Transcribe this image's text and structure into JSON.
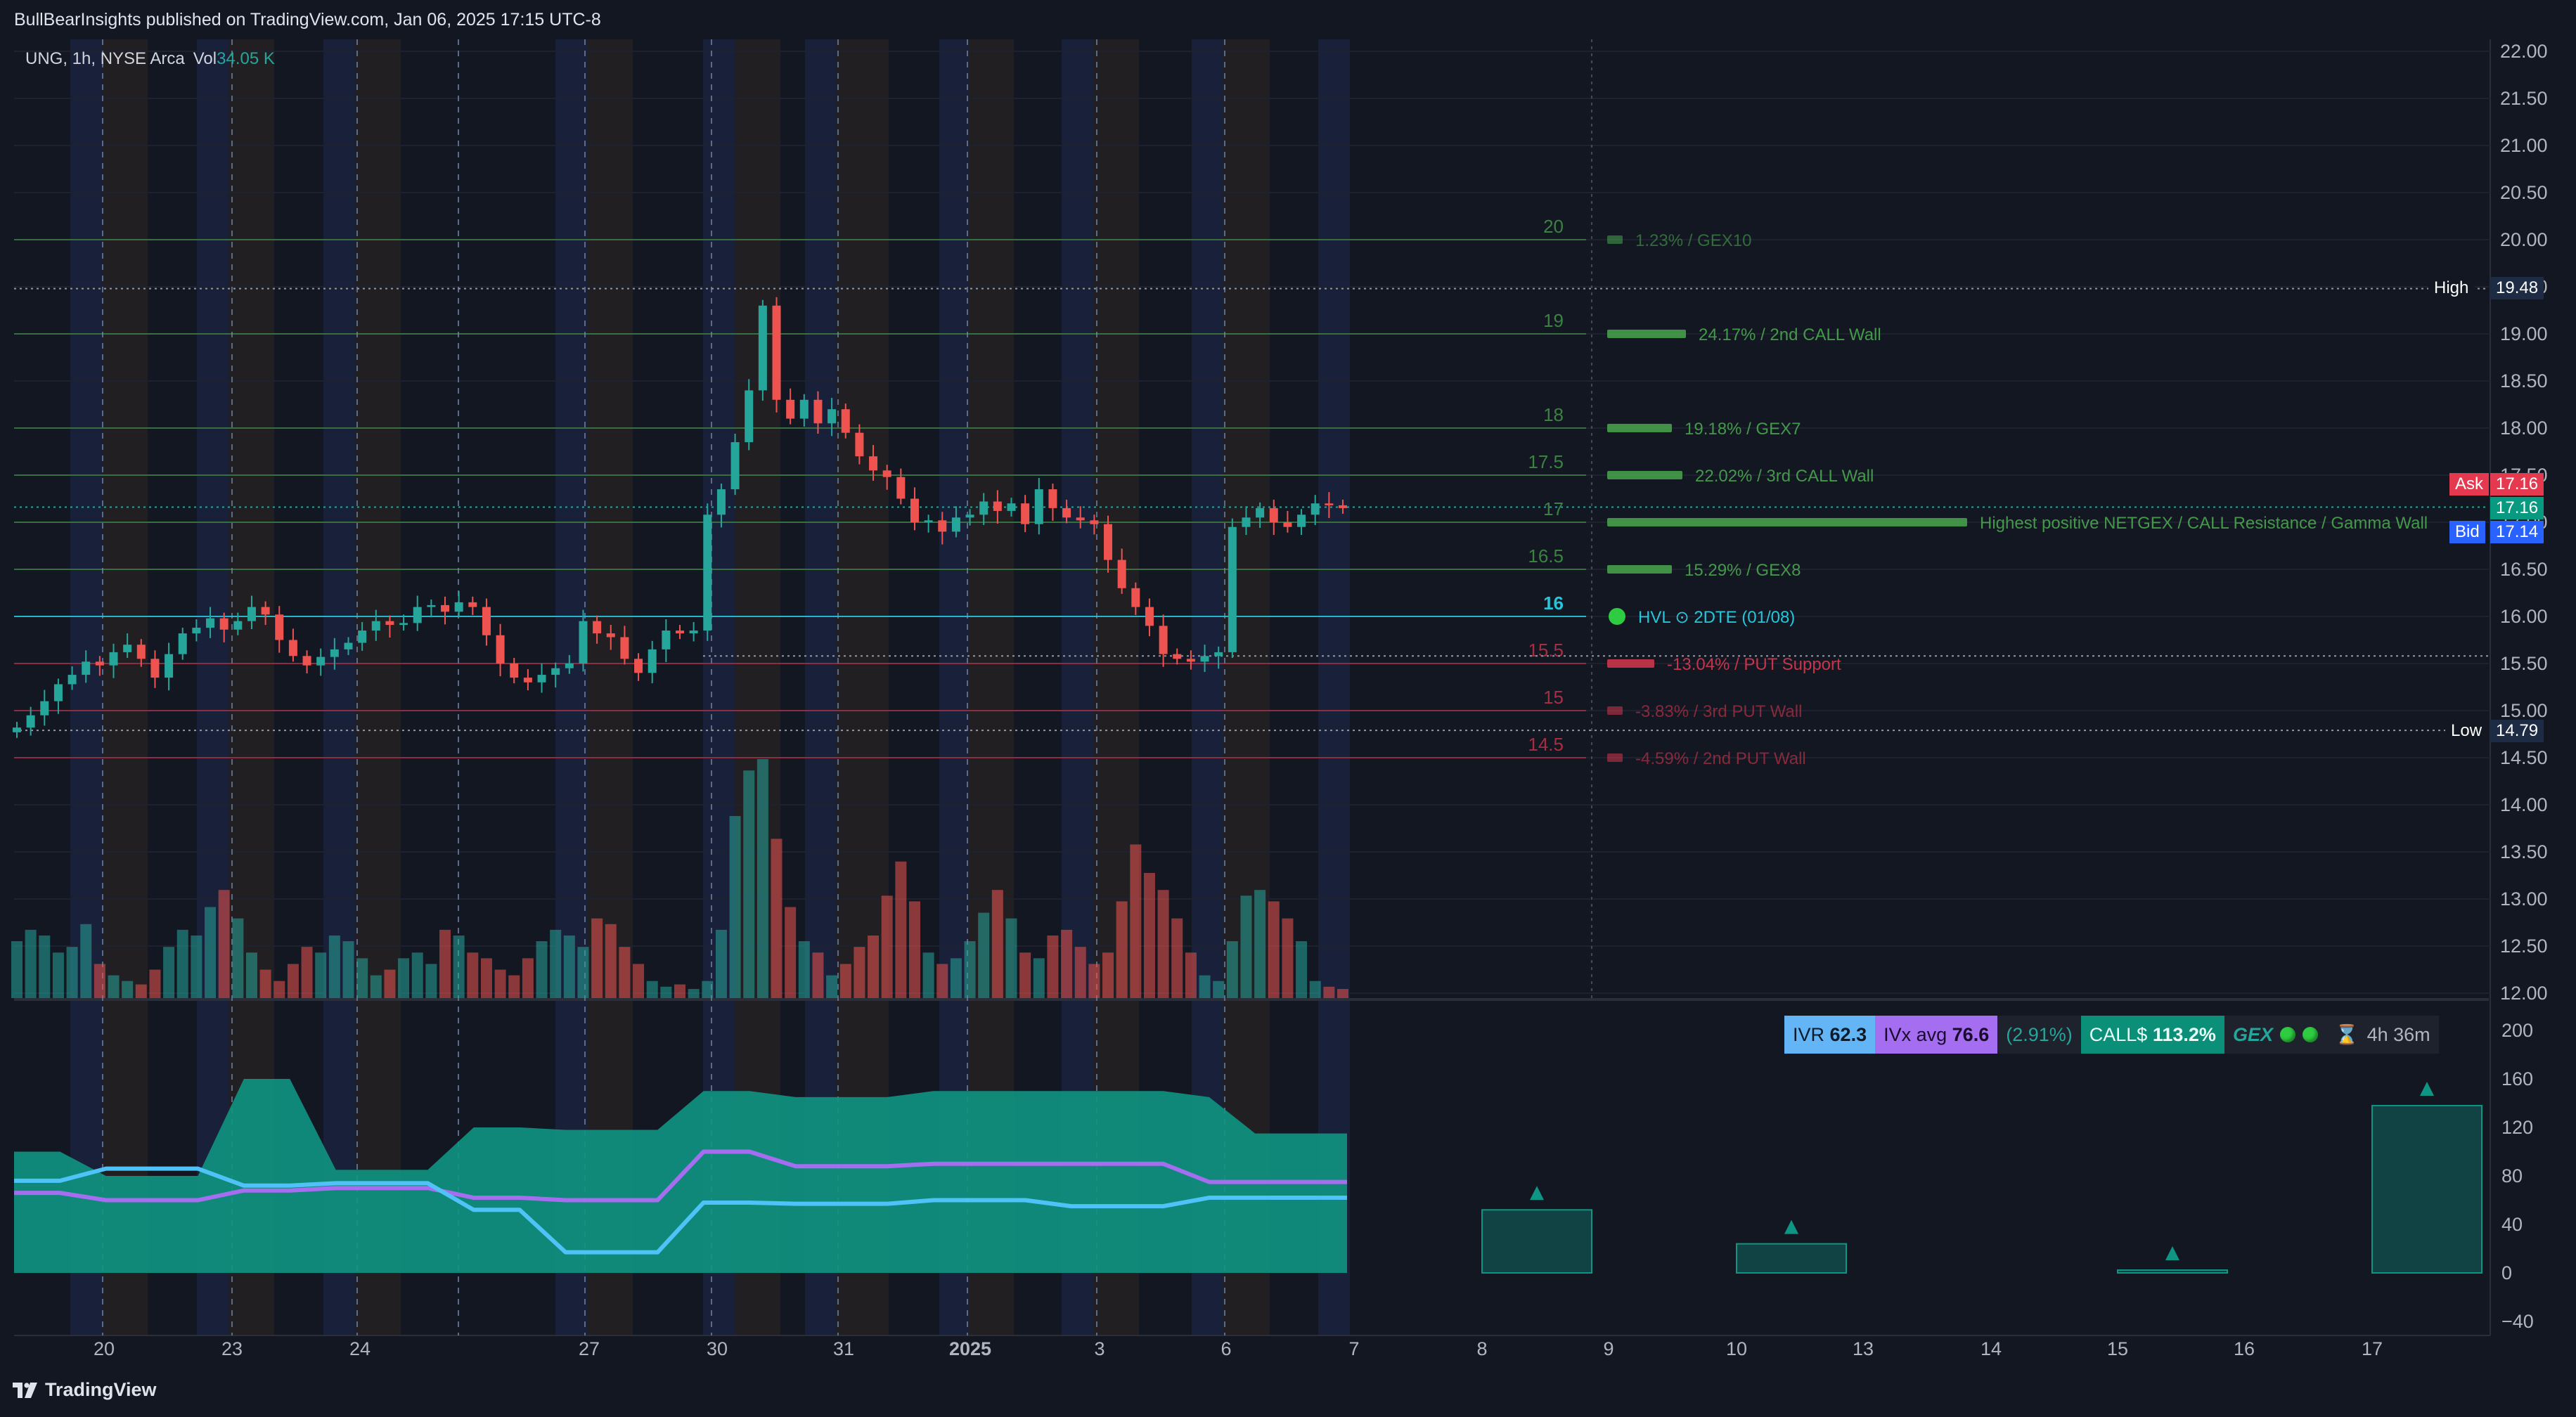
{
  "header": {
    "publisher": "BullBearInsights published on TradingView.com, Jan 06, 2025 17:15 UTC-8"
  },
  "legend": {
    "symbol": "UNG, 1h, NYSE Arca",
    "vol_label": "Vol",
    "vol_value": "34.05 K"
  },
  "footer": {
    "brand": "TradingView"
  },
  "colors": {
    "background": "#131722",
    "up": "#26a69a",
    "down": "#ef5350",
    "call_level": "#4caf50",
    "put_level": "#e53950",
    "hvl": "#26c6da",
    "iv_line": "#4fc3f7",
    "ivx_line": "#a56ef0",
    "iv_area": "#0f9583"
  },
  "info_strip": {
    "ivr_label": "IVR",
    "ivr_value": "62.3",
    "ivx_label": "IVx avg",
    "ivx_value": "76.6",
    "change": "(2.91%)",
    "call_label": "CALL$",
    "call_value": "113.2%",
    "gex_label": "GEX",
    "time_left": "4h 36m"
  },
  "price_tags": {
    "high_label": "High",
    "high_value": "19.48",
    "ask_label": "Ask",
    "ask_value": "17.16",
    "last_value": "17.16",
    "bid_label": "Bid",
    "bid_value": "17.14",
    "low_label": "Low",
    "low_value": "14.79"
  },
  "chart_data": [
    {
      "type": "candlestick",
      "symbol": "UNG",
      "interval": "1h",
      "exchange": "NYSE Arca",
      "y_axis": {
        "ticks": [
          "22.00",
          "21.50",
          "21.00",
          "20.50",
          "20.00",
          "19.50",
          "19.00",
          "18.50",
          "18.00",
          "17.50",
          "17.00",
          "16.50",
          "16.00",
          "15.50",
          "15.00",
          "14.50",
          "14.00",
          "13.50",
          "13.00",
          "12.50",
          "12.00"
        ],
        "ylim": [
          12.0,
          22.0
        ]
      },
      "x_axis": {
        "tick_labels": [
          "20",
          "23",
          "24",
          "27",
          "30",
          "31",
          "2025",
          "3",
          "6",
          "7",
          "8",
          "9",
          "10",
          "13",
          "14",
          "15",
          "16",
          "17"
        ]
      },
      "close_series": [
        14.82,
        14.95,
        15.1,
        15.28,
        15.38,
        15.52,
        15.48,
        15.62,
        15.7,
        15.55,
        15.35,
        15.6,
        15.82,
        15.88,
        15.98,
        15.86,
        15.95,
        16.1,
        16.02,
        15.75,
        15.58,
        15.48,
        15.57,
        15.65,
        15.72,
        15.85,
        15.95,
        15.91,
        15.93,
        16.1,
        16.12,
        16.05,
        16.15,
        16.1,
        15.8,
        15.5,
        15.35,
        15.3,
        15.38,
        15.45,
        15.5,
        15.95,
        15.82,
        15.78,
        15.55,
        15.4,
        15.65,
        15.85,
        15.82,
        15.85,
        17.08,
        17.35,
        17.85,
        18.4,
        19.3,
        18.3,
        18.1,
        18.3,
        18.05,
        18.2,
        17.95,
        17.7,
        17.55,
        17.48,
        17.25,
        17.0,
        17.02,
        16.9,
        17.05,
        17.08,
        17.22,
        17.12,
        17.2,
        16.98,
        17.35,
        17.15,
        17.05,
        17.02,
        16.98,
        16.6,
        16.3,
        16.1,
        15.9,
        15.6,
        15.55,
        15.52,
        15.58,
        15.62,
        16.95,
        17.05,
        17.15,
        17.0,
        16.95,
        17.08,
        17.2,
        17.18,
        17.15
      ],
      "volume_series": [
        50,
        60,
        55,
        40,
        45,
        65,
        30,
        20,
        15,
        12,
        25,
        45,
        60,
        55,
        80,
        95,
        70,
        40,
        25,
        15,
        30,
        45,
        40,
        55,
        50,
        35,
        20,
        25,
        35,
        40,
        30,
        60,
        55,
        40,
        35,
        25,
        20,
        35,
        50,
        60,
        55,
        45,
        70,
        65,
        45,
        30,
        15,
        10,
        12,
        8,
        15,
        60,
        160,
        200,
        210,
        140,
        80,
        50,
        40,
        20,
        30,
        45,
        55,
        90,
        120,
        85,
        40,
        30,
        35,
        50,
        75,
        95,
        70,
        40,
        35,
        55,
        60,
        45,
        30,
        40,
        85,
        135,
        110,
        95,
        70,
        40,
        20,
        15,
        50,
        90,
        95,
        85,
        70,
        50,
        15,
        10,
        8
      ],
      "price_range": {
        "high": 19.48,
        "low": 14.79
      }
    },
    {
      "type": "horizontal_levels",
      "levels": [
        {
          "strike": "20",
          "value": 20.0,
          "label": "1.23% / GEX10",
          "kind": "call",
          "strength": 0.02
        },
        {
          "strike": "19",
          "value": 19.0,
          "label": "24.17% / 2nd CALL Wall",
          "kind": "call",
          "strength": 0.2
        },
        {
          "strike": "18",
          "value": 18.0,
          "label": "19.18% / GEX7",
          "kind": "call",
          "strength": 0.16
        },
        {
          "strike": "17.5",
          "value": 17.5,
          "label": "22.02% / 3rd CALL Wall",
          "kind": "call",
          "strength": 0.19
        },
        {
          "strike": "17",
          "value": 17.0,
          "label": "Highest positive NETGEX / CALL Resistance / Gamma Wall",
          "kind": "call",
          "strength": 1.0
        },
        {
          "strike": "16.5",
          "value": 16.5,
          "label": "15.29% / GEX8",
          "kind": "call",
          "strength": 0.16
        },
        {
          "strike": "16",
          "value": 16.0,
          "label": "HVL",
          "label_suffix": "2DTE (01/08)",
          "kind": "hvl",
          "strength": 0
        },
        {
          "strike": "15.5",
          "value": 15.5,
          "label": "-13.04% / PUT Support",
          "kind": "put",
          "strength": 0.11
        },
        {
          "strike": "15",
          "value": 15.0,
          "label": "-3.83% / 3rd PUT Wall",
          "kind": "put",
          "strength": 0.02
        },
        {
          "strike": "14.5",
          "value": 14.5,
          "label": "-4.59% / 2nd PUT Wall",
          "kind": "put",
          "strength": 0.02
        }
      ]
    },
    {
      "type": "area_line",
      "y_axis": {
        "ticks": [
          "200",
          "160",
          "120",
          "80",
          "40",
          "0",
          "−40"
        ],
        "ylim": [
          -40,
          200
        ]
      },
      "series": [
        {
          "kind": "area",
          "values": [
            100,
            100,
            80,
            80,
            80,
            160,
            160,
            85,
            85,
            85,
            120,
            120,
            118,
            118,
            118,
            150,
            150,
            145,
            145,
            145,
            150,
            150,
            150,
            150,
            150,
            150,
            145,
            115,
            115,
            115
          ]
        },
        {
          "kind": "line",
          "color": "#a56ef0",
          "values": [
            66,
            66,
            60,
            60,
            60,
            68,
            68,
            70,
            70,
            70,
            62,
            62,
            60,
            60,
            60,
            100,
            100,
            88,
            88,
            88,
            90,
            90,
            90,
            90,
            90,
            90,
            75,
            75,
            75,
            75
          ]
        },
        {
          "kind": "line",
          "color": "#4fc3f7",
          "values": [
            76,
            76,
            86,
            86,
            86,
            72,
            72,
            74,
            74,
            74,
            52,
            52,
            17,
            17,
            17,
            58,
            58,
            57,
            57,
            57,
            60,
            60,
            60,
            55,
            55,
            55,
            62,
            62,
            62,
            62
          ]
        }
      ],
      "future_bars": [
        {
          "value": 52
        },
        {
          "value": 24
        },
        {
          "value": 2
        },
        {
          "value": 138
        }
      ]
    }
  ]
}
